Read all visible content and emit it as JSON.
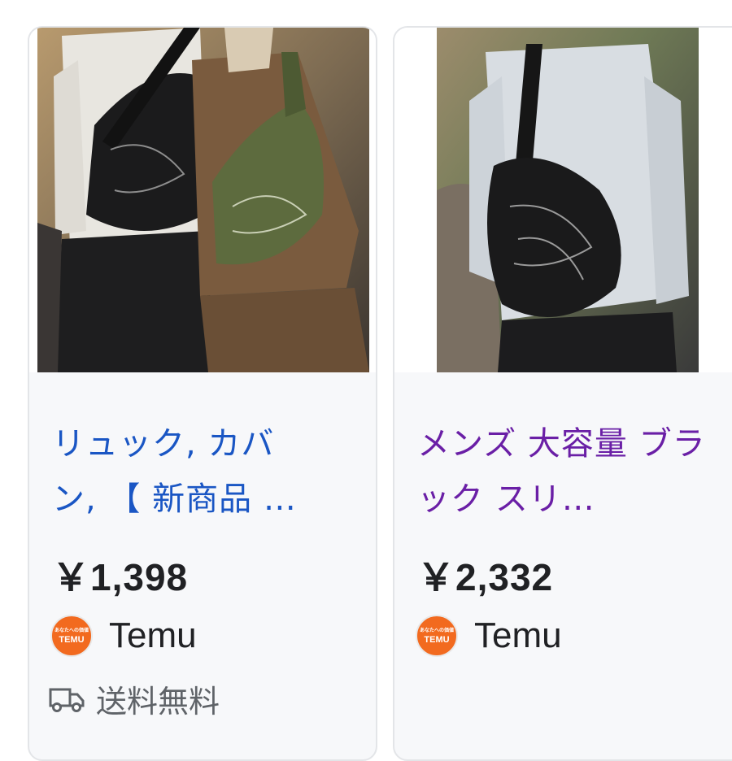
{
  "products": [
    {
      "title": "リュック, カバン, 【 新商品 …",
      "price": "￥1,398",
      "seller": "Temu",
      "seller_logo_text_jp": "あなたへの価値",
      "seller_logo_text": "TEMU",
      "shipping": "送料無料",
      "image_icon": "product-photo"
    },
    {
      "title": "メンズ 大容量 ブラック スリ…",
      "price": "￥2,332",
      "seller": "Temu",
      "seller_logo_text_jp": "あなたへの価値",
      "seller_logo_text": "TEMU",
      "image_icon": "product-photo"
    }
  ],
  "colors": {
    "title_link": "#1a56c4",
    "title_visited": "#6a1fa6",
    "seller_brand": "#f26a1f"
  }
}
